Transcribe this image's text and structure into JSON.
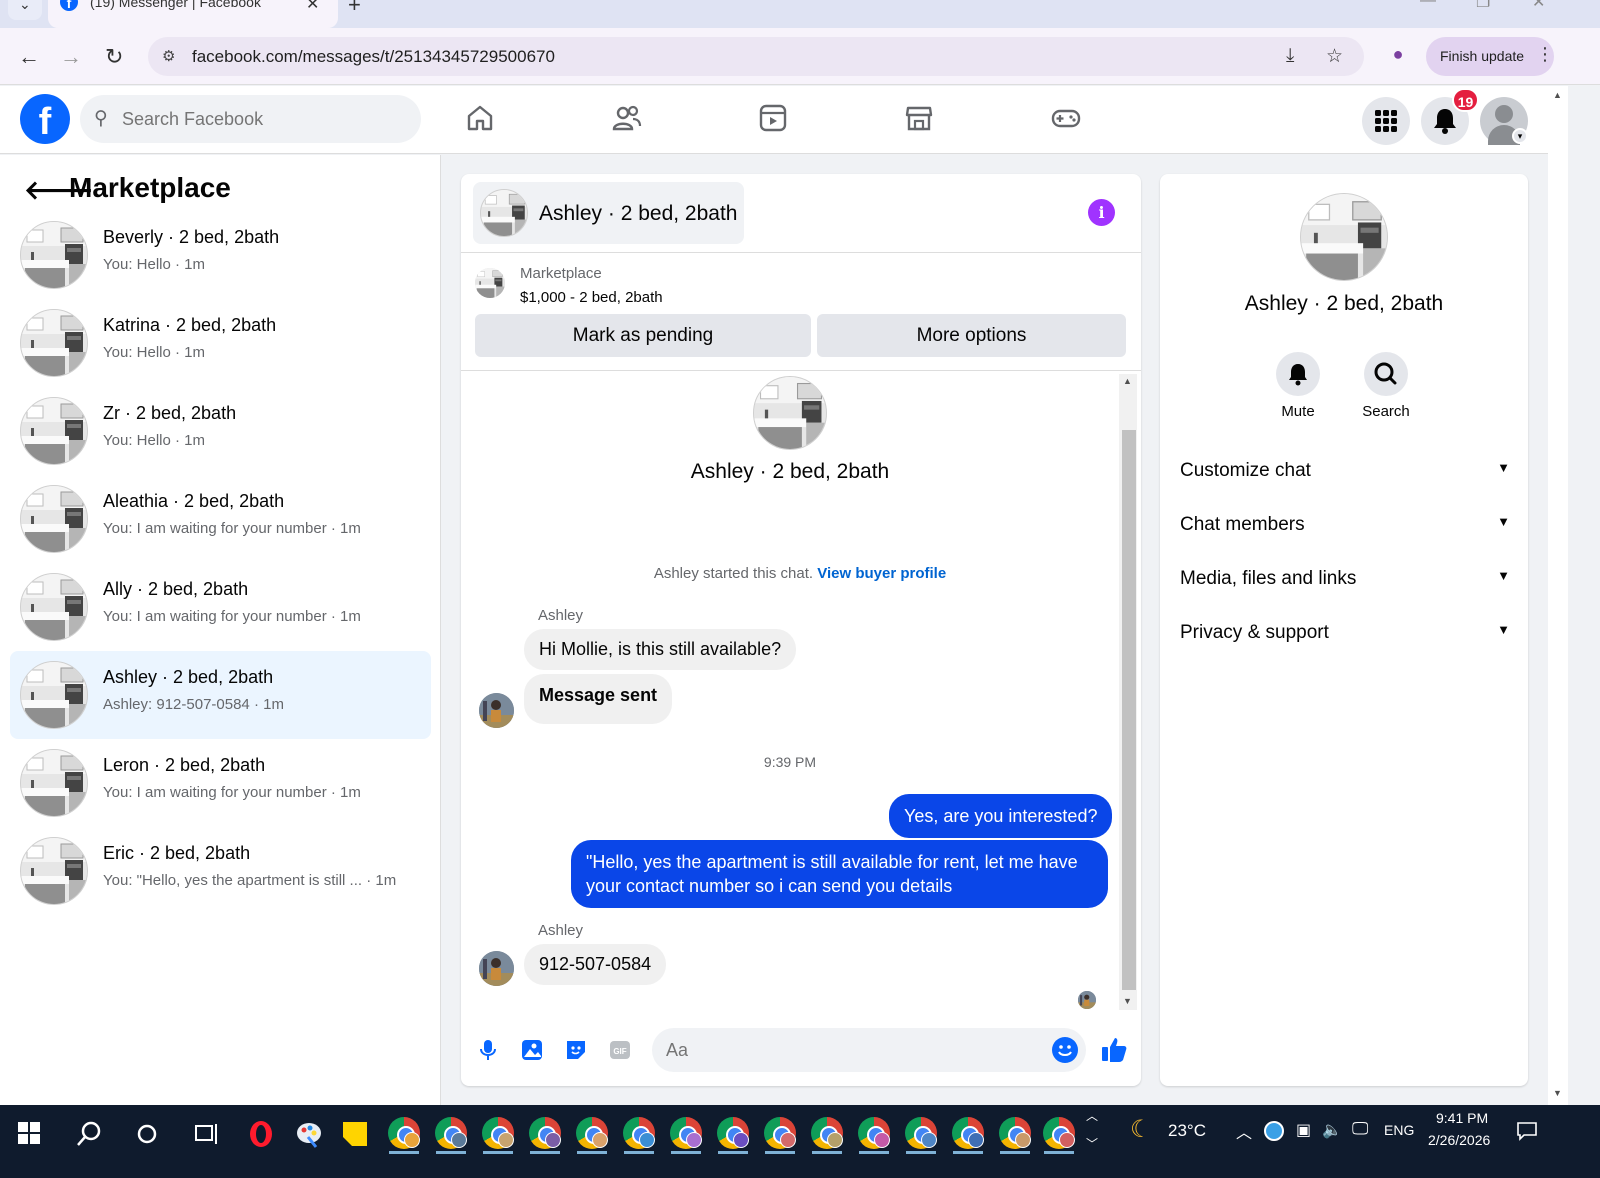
{
  "browser": {
    "tab_title": "(19) Messenger | Facebook",
    "url": "facebook.com/messages/t/25134345729500670",
    "finish_update_label": "Finish update"
  },
  "header": {
    "search_placeholder": "Search Facebook",
    "notification_count": "19",
    "brand_color": "#0866ff"
  },
  "sidebar": {
    "title": "Marketplace",
    "conversations": [
      {
        "name": "Beverly · 2 bed, 2bath",
        "preview": "You: Hello · 1m",
        "active": false
      },
      {
        "name": "Katrina · 2 bed, 2bath",
        "preview": "You: Hello · 1m",
        "active": false
      },
      {
        "name": "Zr · 2 bed, 2bath",
        "preview": "You: Hello · 1m",
        "active": false
      },
      {
        "name": "Aleathia · 2 bed, 2bath",
        "preview": "You: I am waiting for your number · 1m",
        "active": false
      },
      {
        "name": "Ally · 2 bed, 2bath",
        "preview": "You: I am waiting for your number · 1m",
        "active": false
      },
      {
        "name": "Ashley · 2 bed, 2bath",
        "preview": "Ashley: 912-507-0584 · 1m",
        "active": true
      },
      {
        "name": "Leron · 2 bed, 2bath",
        "preview": "You: I am waiting for your number · 1m",
        "active": false
      },
      {
        "name": "Eric · 2 bed, 2bath",
        "preview": "You: \"Hello, yes the apartment is still ... · 1m",
        "active": false
      }
    ]
  },
  "chat": {
    "header_name": "Ashley · 2 bed, 2bath",
    "marketplace_label": "Marketplace",
    "listing": "$1,000 - 2 bed, 2bath",
    "mark_pending_label": "Mark as pending",
    "more_options_label": "More options",
    "profile_name": "Ashley · 2 bed, 2bath",
    "started_text": "Ashley started this chat.",
    "view_buyer_profile": "View buyer profile",
    "sender_1": "Ashley",
    "msg_in_1": "Hi Mollie, is this still available?",
    "msg_in_2": "Message sent",
    "timestamp": "9:39 PM",
    "msg_out_1": "Yes, are you interested?",
    "msg_out_2": "\"Hello, yes the apartment is still available for rent, let me have your contact number so i can send you details",
    "sender_2": "Ashley",
    "msg_in_3": "912-507-0584",
    "composer_placeholder": "Aa",
    "out_bubble_color": "#0a46e8"
  },
  "right_panel": {
    "name": "Ashley · 2 bed, 2bath",
    "mute_label": "Mute",
    "search_label": "Search",
    "sections": [
      "Customize chat",
      "Chat members",
      "Media, files and links",
      "Privacy & support"
    ]
  },
  "taskbar": {
    "weather": "23°C",
    "language": "ENG",
    "time": "9:41 PM",
    "date": "2/26/2026"
  }
}
